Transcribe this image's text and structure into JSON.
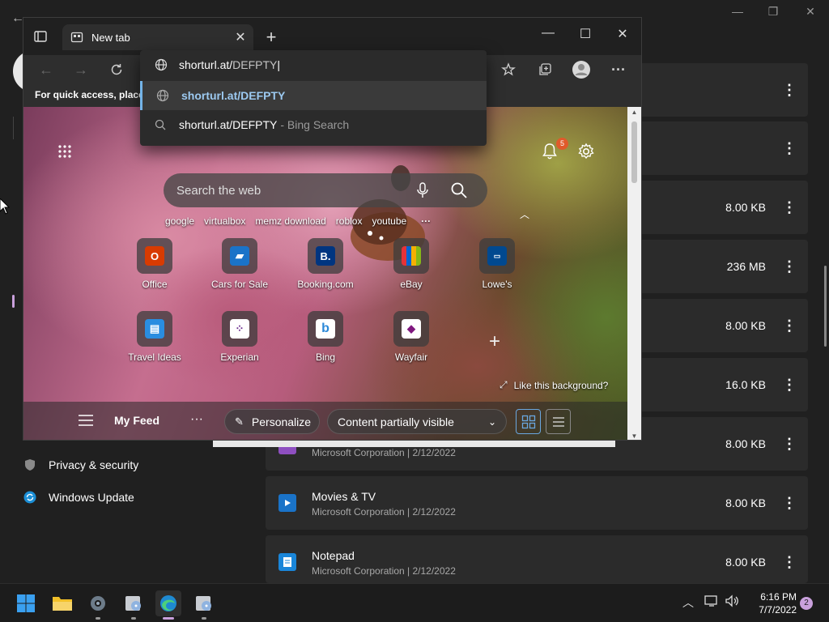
{
  "settings": {
    "nav": [
      {
        "label": "Privacy & security",
        "icon": "shield-icon"
      },
      {
        "label": "Windows Update",
        "icon": "windows-update-icon"
      }
    ],
    "apps": [
      {
        "name": "",
        "meta": "",
        "size": ""
      },
      {
        "name": "",
        "meta": "",
        "size": ""
      },
      {
        "name": "",
        "meta": "",
        "size": "8.00 KB"
      },
      {
        "name": "",
        "meta": "",
        "size": "236 MB"
      },
      {
        "name": "",
        "meta": "",
        "size": "8.00 KB"
      },
      {
        "name": "",
        "meta": "",
        "size": "16.0 KB"
      },
      {
        "name": "",
        "meta": "Microsoft Corporation  |  2/12/2022",
        "size": "8.00 KB"
      },
      {
        "name": "Movies & TV",
        "meta": "Microsoft Corporation  |  2/12/2022",
        "size": "8.00 KB"
      },
      {
        "name": "Notepad",
        "meta": "Microsoft Corporation  |  2/12/2022",
        "size": "8.00 KB"
      }
    ],
    "more_glyph": "⋮"
  },
  "edge": {
    "tab_title": "New tab",
    "favorites_bar_text": "For quick access, place y",
    "omnibox": {
      "typed_prefix": "shorturl.at/",
      "typed_rest": "DEFPTY",
      "suggestions": [
        {
          "text": "shorturl.at/DEFPTY",
          "sub": "",
          "icon": "globe-icon"
        },
        {
          "text": "shorturl.at/DEFPTY",
          "sub": "- Bing Search",
          "icon": "search-icon"
        }
      ]
    },
    "newtab": {
      "notification_count": "5",
      "search_placeholder": "Search the web",
      "quick_links": [
        "google",
        "virtualbox",
        "memz download",
        "roblox",
        "youtube"
      ],
      "tiles": [
        {
          "label": "Office",
          "icon": "office-icon",
          "color": "#d83b01",
          "glyph": "O"
        },
        {
          "label": "Cars for Sale",
          "icon": "cars-icon",
          "color": "#1a73c8",
          "glyph": "🚗"
        },
        {
          "label": "Booking.com",
          "icon": "booking-icon",
          "color": "#003580",
          "glyph": "B."
        },
        {
          "label": "eBay",
          "icon": "ebay-icon",
          "color": "#e53238",
          "glyph": "▣"
        },
        {
          "label": "Lowe's",
          "icon": "lowes-icon",
          "color": "#004990",
          "glyph": "▭"
        },
        {
          "label": "Travel Ideas",
          "icon": "travel-icon",
          "color": "#2a8de0",
          "glyph": "🧳"
        },
        {
          "label": "Experian",
          "icon": "experian-icon",
          "color": "#6b2c8f",
          "glyph": "⁘"
        },
        {
          "label": "Bing",
          "icon": "bing-icon",
          "color": "#2b88d8",
          "glyph": "b"
        },
        {
          "label": "Wayfair",
          "icon": "wayfair-icon",
          "color": "#7f187f",
          "glyph": "◆"
        }
      ],
      "like_background": "Like this background?",
      "feed": {
        "my_feed": "My Feed",
        "personalize": "Personalize",
        "content_visibility": "Content partially visible"
      }
    }
  },
  "taskbar": {
    "time": "6:16 PM",
    "date": "7/7/2022",
    "notifications": "2"
  }
}
